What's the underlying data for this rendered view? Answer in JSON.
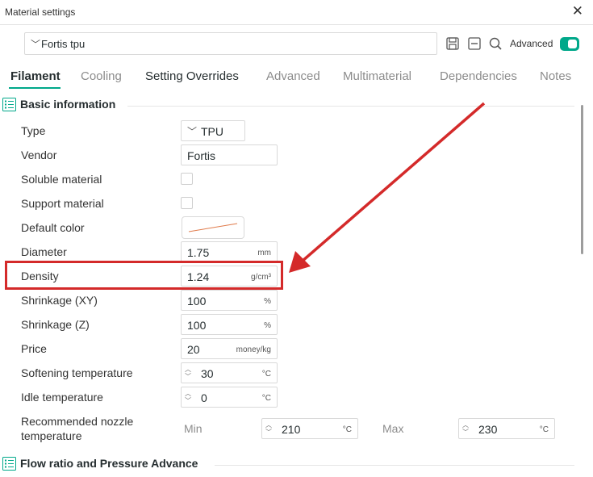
{
  "window": {
    "title": "Material settings"
  },
  "preset": {
    "name": "Fortis tpu"
  },
  "toolbar": {
    "advanced_label": "Advanced",
    "advanced_on": true
  },
  "tabs": [
    {
      "label": "Filament",
      "active": true
    },
    {
      "label": "Cooling"
    },
    {
      "label": "Setting Overrides"
    },
    {
      "label": "Advanced"
    },
    {
      "label": "Multimaterial"
    },
    {
      "label": "Dependencies"
    },
    {
      "label": "Notes"
    }
  ],
  "sections": {
    "basic": "Basic information",
    "flow": "Flow ratio and Pressure Advance"
  },
  "fields": {
    "type": {
      "label": "Type",
      "value": "TPU"
    },
    "vendor": {
      "label": "Vendor",
      "value": "Fortis"
    },
    "soluble": {
      "label": "Soluble material",
      "checked": false
    },
    "support": {
      "label": "Support material",
      "checked": false
    },
    "color": {
      "label": "Default color"
    },
    "diameter": {
      "label": "Diameter",
      "value": "1.75",
      "unit": "mm"
    },
    "density": {
      "label": "Density",
      "value": "1.24",
      "unit": "g/cm³"
    },
    "shrink_xy": {
      "label": "Shrinkage (XY)",
      "value": "100",
      "unit": "%"
    },
    "shrink_z": {
      "label": "Shrinkage (Z)",
      "value": "100",
      "unit": "%"
    },
    "price": {
      "label": "Price",
      "value": "20",
      "unit": "money/kg"
    },
    "softening": {
      "label": "Softening temperature",
      "value": "30",
      "unit": "°C"
    },
    "idle": {
      "label": "Idle temperature",
      "value": "0",
      "unit": "°C"
    },
    "nozzle": {
      "label_line1": "Recommended nozzle",
      "label_line2": "temperature",
      "min_label": "Min",
      "min_value": "210",
      "min_unit": "°C",
      "max_label": "Max",
      "max_value": "230",
      "max_unit": "°C"
    }
  },
  "colors": {
    "accent": "#00a88a",
    "annotation": "#d42a2a"
  },
  "icons": {
    "close": "close-icon",
    "save": "save-icon",
    "delete": "delete-preset-icon",
    "search": "search-icon",
    "section": "list-section-icon"
  }
}
